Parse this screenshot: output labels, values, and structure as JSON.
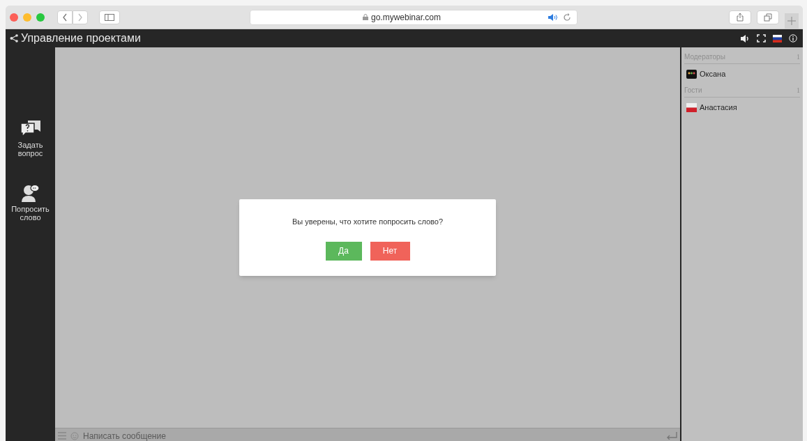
{
  "browser": {
    "url": "go.mywebinar.com"
  },
  "app_bar": {
    "title": "Управление проектами"
  },
  "sidebar": {
    "items": [
      {
        "kind": "question",
        "label": "Задать вопрос"
      },
      {
        "kind": "speak",
        "label": "Попросить слово"
      }
    ]
  },
  "dialog": {
    "message": "Вы уверены, что хотите попросить слово?",
    "buttons": [
      {
        "kind": "confirm",
        "label": "Да"
      },
      {
        "kind": "cancel",
        "label": "Нет"
      }
    ]
  },
  "participants": {
    "groups": [
      {
        "title": "Модераторы",
        "count": "1",
        "members": [
          {
            "name": "Оксана",
            "kind": "dots"
          }
        ]
      },
      {
        "title": "Гости",
        "count": "1",
        "members": [
          {
            "name": "Анастасия",
            "kind": "flag"
          }
        ]
      }
    ]
  },
  "chat": {
    "placeholder": "Написать сообщение"
  }
}
